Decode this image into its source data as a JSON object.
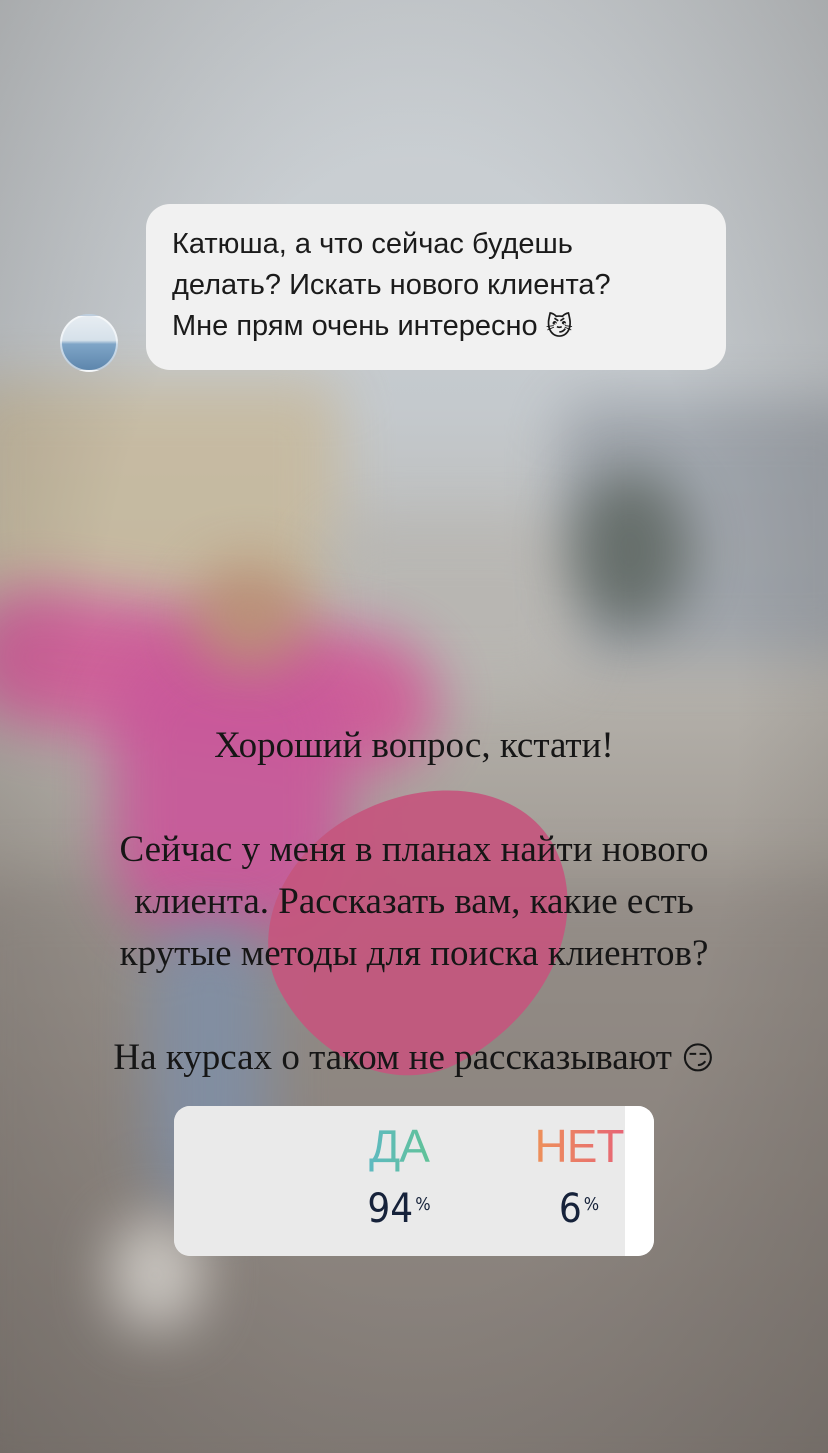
{
  "question": {
    "text": "Катюша, а что сейчас будешь\nделать? Искать нового клиента?\nМне прям очень интересно",
    "emoji": "😼"
  },
  "answer": {
    "lines": [
      "Хороший вопрос, кстати!",
      "",
      "Сейчас у меня в планах найти нового",
      "клиента. Рассказать вам, какие есть",
      "крутые методы для поиска клиентов?",
      "",
      "На курсах о таком не рассказывают"
    ],
    "emoji": "😏"
  },
  "poll": {
    "options": [
      {
        "label": "ДА",
        "percent": 94,
        "percent_text": "94",
        "color_from": "#5bb3df",
        "color_to": "#63c87a"
      },
      {
        "label": "НЕТ",
        "percent": 6,
        "percent_text": "6",
        "color_from": "#f0a050",
        "color_to": "#e4567f"
      }
    ],
    "percent_symbol": "%"
  },
  "colors": {
    "bubble_bg": "#f1f1f1",
    "sticker_pink": "#c4567e",
    "poll_bg": "#ececec"
  }
}
